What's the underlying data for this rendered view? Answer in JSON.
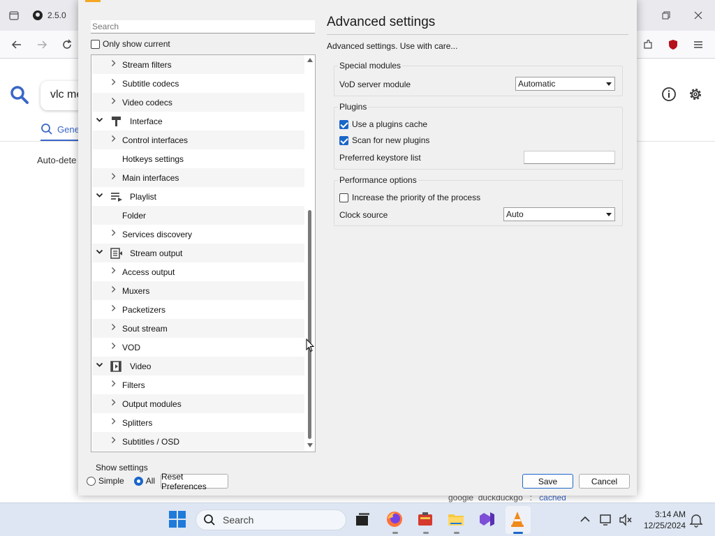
{
  "browser": {
    "tab_label": "2.5.0",
    "search_query": "vlc me",
    "general_tab": "Gene",
    "autodetect_text": "Auto-dete",
    "footer_google": "google",
    "footer_duckduckgo": "duckduckgo",
    "footer_sep": ":",
    "footer_cached": "cached"
  },
  "dialog": {
    "search_placeholder": "Search",
    "only_show_current": "Only show current",
    "tree": [
      {
        "label": "Stream filters",
        "level": 1,
        "expander": "collapsed"
      },
      {
        "label": "Subtitle codecs",
        "level": 1,
        "expander": "collapsed"
      },
      {
        "label": "Video codecs",
        "level": 1,
        "expander": "collapsed"
      },
      {
        "label": "Interface",
        "level": 0,
        "expander": "expanded",
        "icon": "interface-icon"
      },
      {
        "label": "Control interfaces",
        "level": 1,
        "expander": "collapsed"
      },
      {
        "label": "Hotkeys settings",
        "level": 1,
        "expander": "none"
      },
      {
        "label": "Main interfaces",
        "level": 1,
        "expander": "collapsed"
      },
      {
        "label": "Playlist",
        "level": 0,
        "expander": "expanded",
        "icon": "playlist-icon"
      },
      {
        "label": "Folder",
        "level": 1,
        "expander": "none"
      },
      {
        "label": "Services discovery",
        "level": 1,
        "expander": "collapsed"
      },
      {
        "label": "Stream output",
        "level": 0,
        "expander": "expanded",
        "icon": "stream-output-icon"
      },
      {
        "label": "Access output",
        "level": 1,
        "expander": "collapsed"
      },
      {
        "label": "Muxers",
        "level": 1,
        "expander": "collapsed"
      },
      {
        "label": "Packetizers",
        "level": 1,
        "expander": "collapsed"
      },
      {
        "label": "Sout stream",
        "level": 1,
        "expander": "collapsed"
      },
      {
        "label": "VOD",
        "level": 1,
        "expander": "collapsed"
      },
      {
        "label": "Video",
        "level": 0,
        "expander": "expanded",
        "icon": "video-icon"
      },
      {
        "label": "Filters",
        "level": 1,
        "expander": "collapsed"
      },
      {
        "label": "Output modules",
        "level": 1,
        "expander": "collapsed"
      },
      {
        "label": "Splitters",
        "level": 1,
        "expander": "collapsed"
      },
      {
        "label": "Subtitles / OSD",
        "level": 1,
        "expander": "collapsed"
      }
    ],
    "show_settings": {
      "title": "Show settings",
      "simple": "Simple",
      "all": "All",
      "selected": "All"
    },
    "reset_label": "Reset Preferences",
    "save_label": "Save",
    "cancel_label": "Cancel",
    "panel": {
      "title": "Advanced settings",
      "description": "Advanced settings. Use with care...",
      "special_modules": {
        "title": "Special modules",
        "vod_label": "VoD server module",
        "vod_value": "Automatic"
      },
      "plugins": {
        "title": "Plugins",
        "use_cache_label": "Use a plugins cache",
        "use_cache_checked": true,
        "scan_label": "Scan for new plugins",
        "scan_checked": true,
        "keystore_label": "Preferred keystore list",
        "keystore_value": ""
      },
      "performance": {
        "title": "Performance options",
        "priority_label": "Increase the priority of the process",
        "priority_checked": false,
        "clock_label": "Clock source",
        "clock_value": "Auto"
      }
    }
  },
  "taskbar": {
    "search_label": "Search",
    "time": "3:14 AM",
    "date": "12/25/2024"
  },
  "colors": {
    "accent": "#1a66c9",
    "dialog_bg": "#f0f0f0",
    "taskbar_bg": "#dde6f2",
    "vlc_orange": "#f5a623"
  }
}
